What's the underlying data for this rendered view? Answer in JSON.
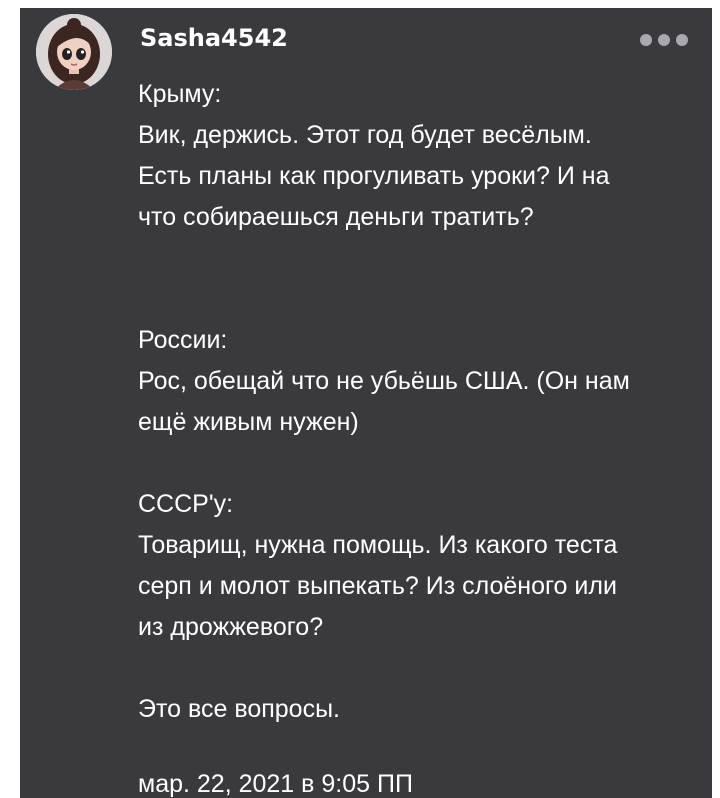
{
  "post": {
    "username": "Sasha4542",
    "avatar_icon": "cartoon-girl-avatar",
    "more_icon": "ellipsis-icon",
    "lines": {
      "l1": "Крыму:",
      "l2": "Вик, держись. Этот год будет весёлым.",
      "l3": "Есть планы как прогуливать уроки? И на",
      "l4": "что собираешься деньги тратить?",
      "l5": "России:",
      "l6": "Рос, обещай что не убьёшь США. (Он нам",
      "l7": "ещё живым нужен)",
      "l8": "СССР'у:",
      "l9": "Товарищ, нужна помощь. Из какого теста",
      "l10": "серп и молот выпекать? Из слоёного или",
      "l11": "из дрожжевого?",
      "l12": "Это все вопросы."
    },
    "date": "мар. 22, 2021 в 9:05 ПП"
  },
  "colors": {
    "background": "#3a393e",
    "text": "#ffffff",
    "menu_dots": "#a9a8ae"
  }
}
